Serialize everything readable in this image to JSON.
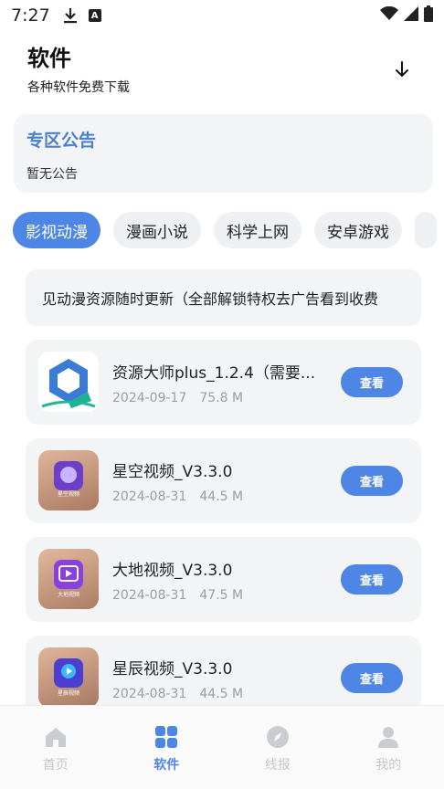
{
  "status_bar": {
    "time": "7:27",
    "icons": [
      "download-icon",
      "a-notification-icon",
      "wifi-icon",
      "cellular-icon",
      "battery-icon"
    ]
  },
  "header": {
    "title": "软件",
    "subtitle": "各种软件免费下载"
  },
  "notice": {
    "title": "专区公告",
    "body": "暂无公告"
  },
  "tabs": [
    {
      "label": "影视动漫",
      "active": true
    },
    {
      "label": "漫画小说",
      "active": false
    },
    {
      "label": "科学上网",
      "active": false
    },
    {
      "label": "安卓游戏",
      "active": false
    }
  ],
  "marquee": {
    "text": "见动漫资源随时更新（全部解锁特权去广告看到收费"
  },
  "apps": [
    {
      "name": "资源大师plus_1.2.4（需要...",
      "date": "2024-09-17",
      "size": "75.8 M",
      "button": "查看",
      "icon": "resource-master-icon"
    },
    {
      "name": "星空视频_V3.3.0",
      "date": "2024-08-31",
      "size": "44.5 M",
      "button": "查看",
      "icon": "xingkong-video-icon",
      "icon_caption": "星空视频"
    },
    {
      "name": "大地视频_V3.3.0",
      "date": "2024-08-31",
      "size": "47.5 M",
      "button": "查看",
      "icon": "dadi-video-icon",
      "icon_caption": "大地视频"
    },
    {
      "name": "星辰视频_V3.3.0",
      "date": "2024-08-31",
      "size": "44.5 M",
      "button": "查看",
      "icon": "xingchen-video-icon",
      "icon_caption": "星辰视频"
    }
  ],
  "bottom_nav": [
    {
      "label": "首页",
      "icon": "home-icon",
      "active": false
    },
    {
      "label": "软件",
      "icon": "grid-icon",
      "active": true
    },
    {
      "label": "线报",
      "icon": "compass-icon",
      "active": false
    },
    {
      "label": "我的",
      "icon": "user-icon",
      "active": false
    }
  ],
  "colors": {
    "accent": "#4d86e4",
    "notice_title": "#4a7fd0",
    "card_bg": "#f3f4f6",
    "meta_text": "#9a9ea5",
    "nav_inactive": "#c4c7cc"
  }
}
